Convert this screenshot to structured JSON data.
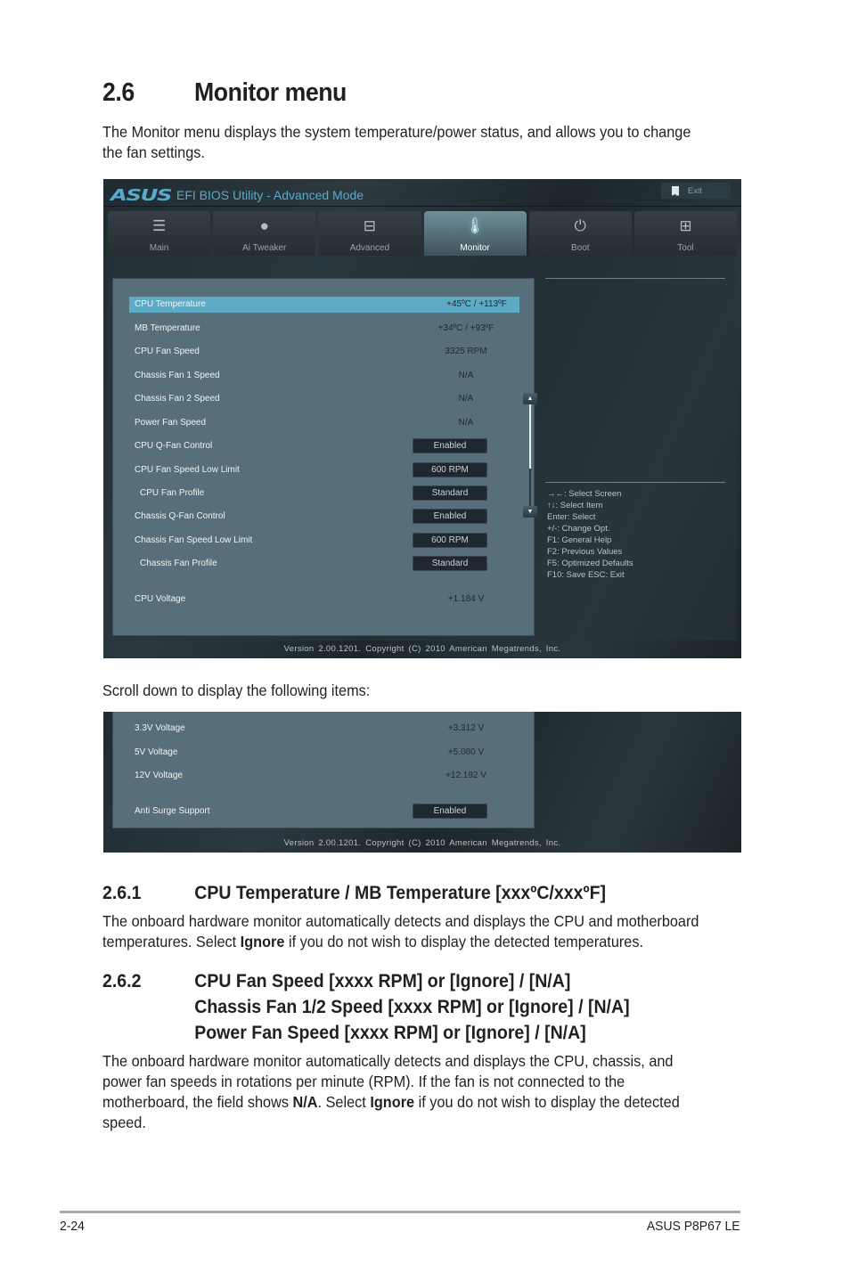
{
  "section": {
    "number": "2.6",
    "title": "Monitor menu",
    "intro": "The Monitor menu displays the system temperature/power status, and allows you to change the fan settings."
  },
  "bios": {
    "logo": "ASUS",
    "title": "EFI BIOS Utility - Advanced Mode",
    "exit_label": "Exit",
    "tabs": [
      {
        "label": "Main",
        "icon": "list-icon"
      },
      {
        "label": "Ai  Tweaker",
        "icon": "tweaker-icon"
      },
      {
        "label": "Advanced",
        "icon": "advanced-info-icon"
      },
      {
        "label": "Monitor",
        "icon": "thermometer-icon"
      },
      {
        "label": "Boot",
        "icon": "power-icon"
      },
      {
        "label": "Tool",
        "icon": "toolbox-icon"
      }
    ],
    "active_tab": "Monitor",
    "items": [
      {
        "name": "CPU Temperature",
        "value": "+45ºC / +113ºF"
      },
      {
        "name": "MB Temperature",
        "value": "+34ºC / +93ºF"
      },
      {
        "name": "CPU Fan Speed",
        "value": "3325 RPM"
      },
      {
        "name": "Chassis Fan 1 Speed",
        "value": "N/A"
      },
      {
        "name": "Chassis Fan 2 Speed",
        "value": "N/A"
      },
      {
        "name": "Power Fan Speed",
        "value": "N/A"
      },
      {
        "name": "CPU Q-Fan Control",
        "value": "Enabled"
      },
      {
        "name": "CPU Fan Speed Low Limit",
        "value": "600 RPM"
      },
      {
        "name": "CPU Fan Profile",
        "value": "Standard"
      },
      {
        "name": "Chassis Q-Fan Control",
        "value": "Enabled"
      },
      {
        "name": "Chassis Fan Speed Low Limit",
        "value": "600 RPM"
      },
      {
        "name": "Chassis Fan Profile",
        "value": "Standard"
      },
      {
        "name": "CPU Voltage",
        "value": "+1.184 V"
      }
    ],
    "help": [
      "→←:  Select Screen",
      "↑↓:  Select Item",
      "Enter:  Select",
      "+/-:  Change Opt.",
      "F1:  General Help",
      "F2:  Previous Values",
      "F5:  Optimized Defaults",
      "F10:  Save    ESC:  Exit"
    ],
    "version": "Version  2.00.1201.  Copyright  (C)  2010  American  Megatrends,  Inc."
  },
  "scroll_caption": "Scroll down to display the following items:",
  "bios_scrolled": {
    "items": [
      {
        "name": "3.3V Voltage",
        "value": "+3.312 V"
      },
      {
        "name": "5V Voltage",
        "value": "+5.080 V"
      },
      {
        "name": "12V Voltage",
        "value": "+12.192 V"
      },
      {
        "name": "Anti Surge Support",
        "value": "Enabled"
      }
    ],
    "version": "Version  2.00.1201.  Copyright  (C)  2010  American  Megatrends,  Inc."
  },
  "subsections": [
    {
      "number": "2.6.1",
      "title_lines": [
        "CPU Temperature / MB Temperature [xxxºC/xxxºF]"
      ],
      "body_parts": [
        {
          "text": "The onboard hardware monitor automatically detects and displays the CPU and motherboard temperatures. Select "
        },
        {
          "text": "Ignore",
          "bold": true
        },
        {
          "text": " if you do not wish to display the detected temperatures."
        }
      ]
    },
    {
      "number": "2.6.2",
      "title_lines": [
        "CPU Fan Speed [xxxx RPM] or [Ignore] / [N/A]",
        "Chassis Fan 1/2 Speed [xxxx RPM] or [Ignore] / [N/A]",
        "Power Fan Speed [xxxx RPM] or [Ignore] / [N/A]"
      ],
      "body_parts": [
        {
          "text": "The onboard hardware monitor automatically detects and displays the CPU, chassis, and power fan speeds in rotations per minute (RPM). If the fan is not connected to the motherboard, the field shows "
        },
        {
          "text": "N/A",
          "bold": true
        },
        {
          "text": ". Select "
        },
        {
          "text": "Ignore",
          "bold": true
        },
        {
          "text": " if you do not wish to display the detected speed."
        }
      ]
    }
  ],
  "footer": {
    "page": "2-24",
    "product": "ASUS P8P67 LE"
  },
  "colors": {
    "accent": "#5aa9cc",
    "selection": "#5eabc6",
    "panel": "#566f7a"
  }
}
